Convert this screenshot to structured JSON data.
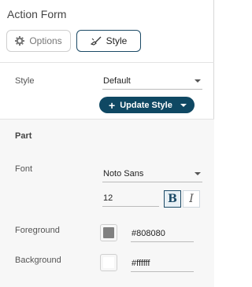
{
  "panel": {
    "title": "Action Form"
  },
  "tabs": [
    {
      "label": "Options",
      "icon": "gear-icon"
    },
    {
      "label": "Style",
      "icon": "paint-brush-icon",
      "active": true
    }
  ],
  "style_section": {
    "label": "Style",
    "value": "Default",
    "update_button": "Update Style"
  },
  "part_section": {
    "heading": "Part",
    "font": {
      "label": "Font",
      "value": "Noto Sans",
      "size": "12",
      "bold_label": "B",
      "italic_label": "I"
    },
    "foreground": {
      "label": "Foreground",
      "color": "#808080",
      "hex": "#808080"
    },
    "background": {
      "label": "Background",
      "color": "#ffffff",
      "hex": "#ffffff"
    }
  },
  "colors": {
    "accent": "#0f4863"
  }
}
